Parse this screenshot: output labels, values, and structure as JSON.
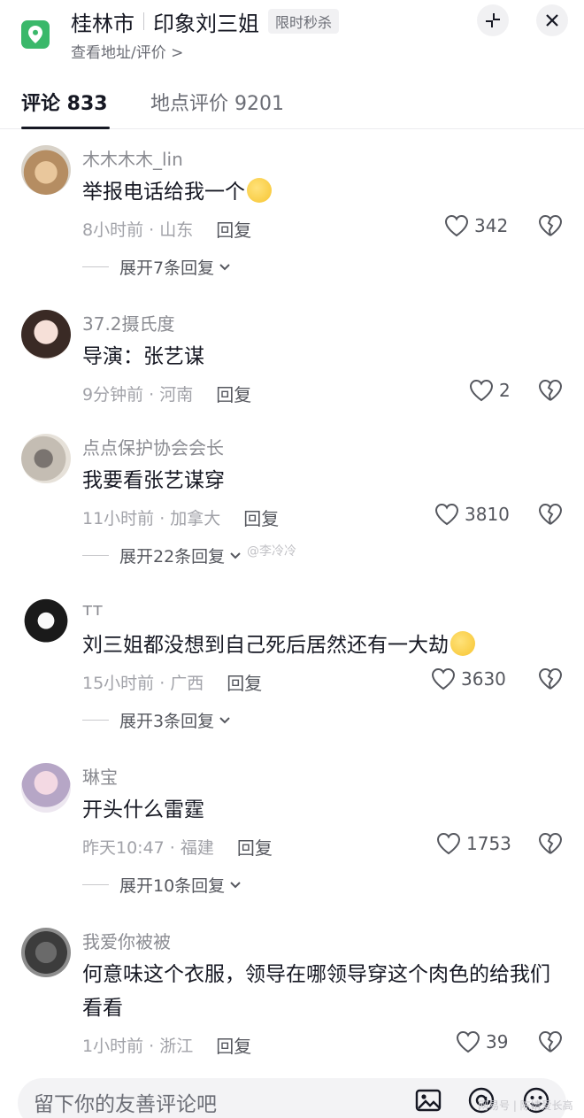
{
  "header": {
    "city": "桂林市",
    "place": "印象刘三姐",
    "badge": "限时秒杀",
    "subtitle": "查看地址/评价 >",
    "accent": "#3ab86a"
  },
  "tabs": [
    {
      "label": "评论 833",
      "active": true
    },
    {
      "label": "地点评价 9201",
      "active": false
    }
  ],
  "comments": [
    {
      "user": "木木木木_lin",
      "text": "举报电话给我一个",
      "emoji": true,
      "time_loc": "8小时前 · 山东",
      "reply": "回复",
      "likes": "342",
      "expand": "展开7条回复"
    },
    {
      "user": "37.2摄氏度",
      "text": "导演：张艺谋",
      "emoji": false,
      "time_loc": "9分钟前 · 河南",
      "reply": "回复",
      "likes": "2",
      "expand": ""
    },
    {
      "user": "点点保护协会会长",
      "text": "我要看张艺谋穿",
      "emoji": false,
      "time_loc": "11小时前 · 加拿大",
      "reply": "回复",
      "likes": "3810",
      "expand": "展开22条回复"
    },
    {
      "user": "ᴛᴛ",
      "text": "刘三姐都没想到自己死后居然还有一大劫",
      "emoji": true,
      "time_loc": "15小时前 · 广西",
      "reply": "回复",
      "likes": "3630",
      "expand": "展开3条回复"
    },
    {
      "user": "琳宝",
      "text": "开头什么雷霆",
      "emoji": false,
      "time_loc": "昨天10:47 · 福建",
      "reply": "回复",
      "likes": "1753",
      "expand": "展开10条回复"
    },
    {
      "user": "我爱你被被",
      "text": "何意味这个衣服，领导在哪领导穿这个肉色的给我们看看",
      "emoji": false,
      "time_loc": "1小时前 · 浙江",
      "reply": "回复",
      "likes": "39",
      "expand": ""
    }
  ],
  "watermarks": {
    "weibo": "@李冷冷",
    "corner": "网易号 | 陈婧爱长高"
  },
  "input": {
    "placeholder": "留下你的友善评论吧"
  }
}
